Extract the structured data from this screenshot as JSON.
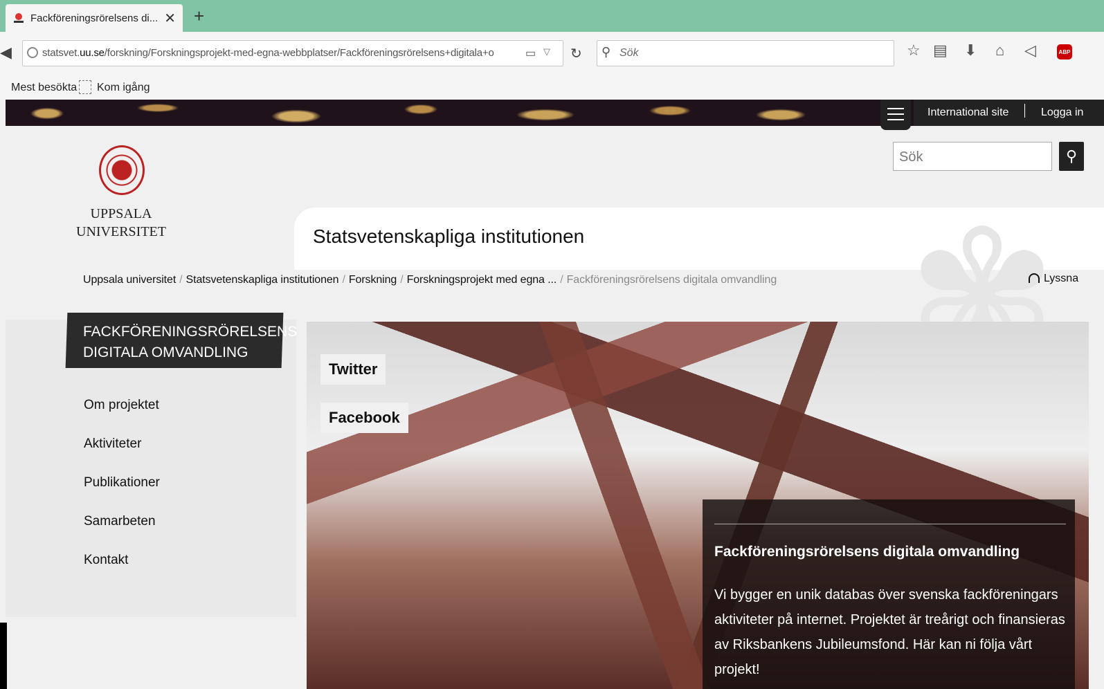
{
  "browser": {
    "tab_title": "Fackföreningsrörelsens di...",
    "tab_close": "✕",
    "new_tab": "+",
    "url_host": "statsvet.",
    "url_domain": "uu.se",
    "url_path": "/forskning/Forskningsprojekt-med-egna-webbplatser/Fackföreningsrörelsens+digitala+o",
    "search_placeholder": "Sök",
    "bookmarks": [
      "Mest besökta",
      "Kom igång"
    ]
  },
  "header": {
    "international_site": "International site",
    "login": "Logga in",
    "search_placeholder": "Sök",
    "logo_line1": "UPPSALA",
    "logo_line2": "UNIVERSITET",
    "department": "Statsvetenskapliga institutionen"
  },
  "breadcrumb": {
    "items": [
      "Uppsala universitet",
      "Statsvetenskapliga institutionen",
      "Forskning",
      "Forskningsprojekt med egna ..."
    ],
    "current": "Fackföreningsrörelsens digitala omvandling",
    "listen": "Lyssna"
  },
  "sidebar": {
    "title_line1": "FACKFÖRENINGSRÖRELSENS",
    "title_line2": "DIGITALA OMVANDLING",
    "items": [
      "Om projektet",
      "Aktiviteter",
      "Publikationer",
      "Samarbeten",
      "Kontakt"
    ]
  },
  "hero": {
    "social": [
      "Twitter",
      "Facebook"
    ],
    "caption_title": "Fackföreningsrörelsens digitala omvandling",
    "caption_text": "Vi bygger en unik databas över svenska fackföreningars aktiviteter på internet. Projektet är treårigt och finansieras av Riksbankens Jubileumsfond. Här kan ni följa vårt projekt!"
  },
  "colors": {
    "tabbar": "#7fc4a5",
    "dark": "#222222",
    "uu_red": "#bb2222"
  }
}
